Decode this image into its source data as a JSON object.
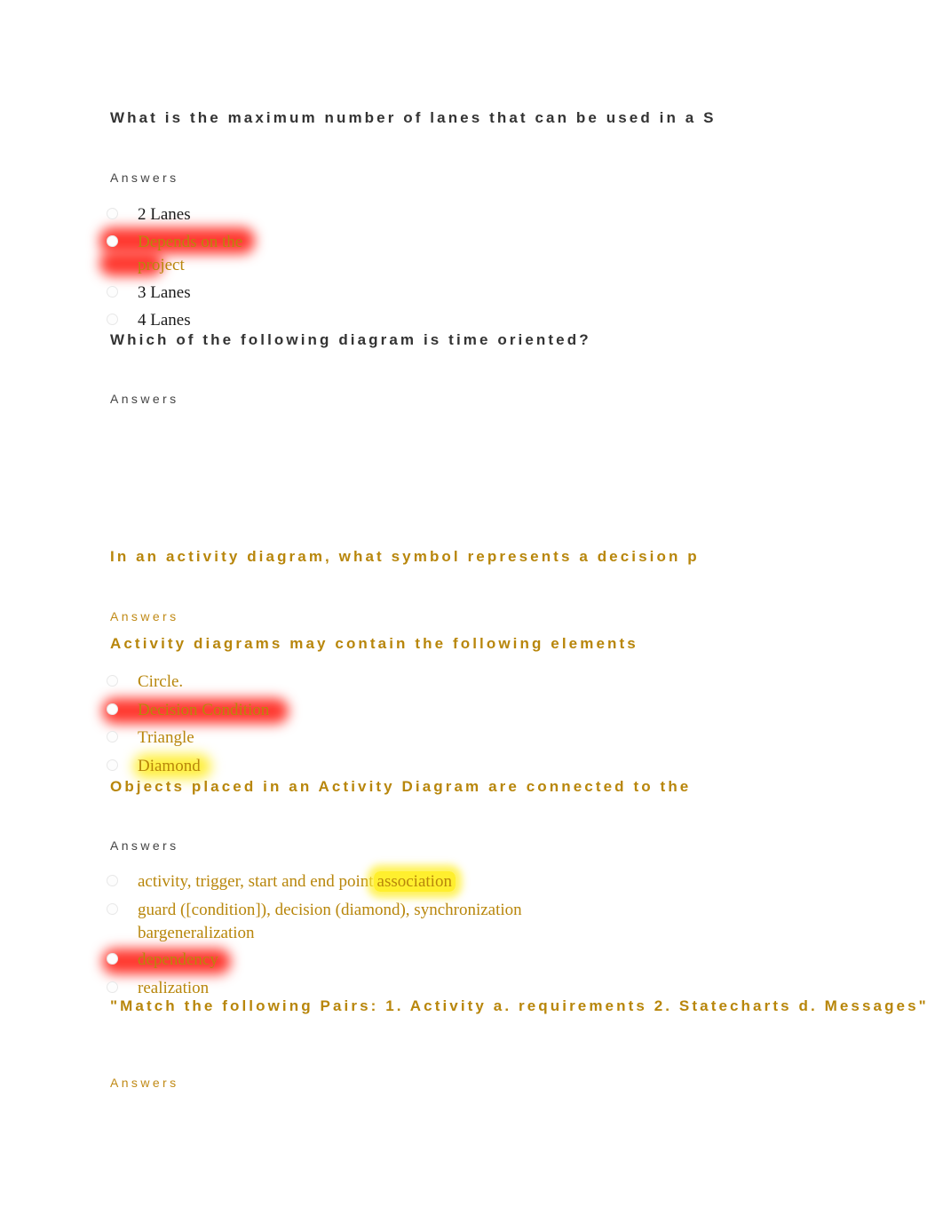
{
  "document": {
    "page_background": "#ffffff",
    "accent_gold": "#b8860b",
    "highlight_red": "#ff2b20",
    "highlight_yellow": "#ffef2e",
    "answers_label": "Answers"
  },
  "questions": [
    {
      "id": "q1",
      "text": "What is the maximum number of lanes that can be used in a S",
      "color": "dark",
      "truncated": true,
      "answers_label": "Answers",
      "answers_label_color": "dark",
      "options": [
        {
          "text": "2 Lanes",
          "color": "dark",
          "highlight": "none"
        },
        {
          "text": "Depends on the project",
          "color": "gold",
          "highlight": "red"
        },
        {
          "text": "3 Lanes",
          "color": "dark",
          "highlight": "none"
        },
        {
          "text": "4 Lanes",
          "color": "dark",
          "highlight": "none"
        }
      ]
    },
    {
      "id": "q2",
      "text": "Which of the following diagram is time oriented?",
      "color": "dark",
      "truncated": false,
      "answers_label": "Answers",
      "answers_label_color": "dark",
      "options": []
    },
    {
      "id": "q3",
      "text": "In an activity diagram, what symbol represents a decision p",
      "color": "gold",
      "truncated": true,
      "answers_label": "Answers",
      "answers_label_color": "gold",
      "options": []
    },
    {
      "id": "q4",
      "text": "Activity diagrams may contain the following elements",
      "color": "gold",
      "truncated": false,
      "options": [
        {
          "text": "Circle.",
          "color": "gold",
          "highlight": "none"
        },
        {
          "text": "Decision Condition",
          "color": "gold",
          "highlight": "red"
        },
        {
          "text": "Triangle",
          "color": "gold",
          "highlight": "none"
        },
        {
          "text": "Diamond",
          "color": "gold",
          "highlight": "yellow"
        }
      ]
    },
    {
      "id": "q5",
      "text": "Objects placed in an Activity Diagram are connected to the",
      "color": "gold",
      "truncated": true,
      "answers_label": "Answers",
      "answers_label_color": "dark",
      "options": [
        {
          "text_plain": "activity, trigger, start and end point",
          "text_highlight": "association",
          "color": "gold",
          "highlight": "yellow"
        },
        {
          "text_plain": "guard ([condition]), decision (diamond), synchronization bar",
          "text_highlight": "generalization",
          "color": "gold",
          "highlight": "none"
        },
        {
          "text": "dependency",
          "color": "gold",
          "highlight": "red"
        },
        {
          "text": "realization",
          "color": "gold",
          "highlight": "none"
        }
      ]
    },
    {
      "id": "q6",
      "text": "\"Match the following Pairs: 1. Activity a. requirements 2. Statecharts d. Messages\"",
      "color": "gold",
      "truncated": false,
      "answers_label": "Answers",
      "answers_label_color": "gold",
      "options": []
    }
  ]
}
